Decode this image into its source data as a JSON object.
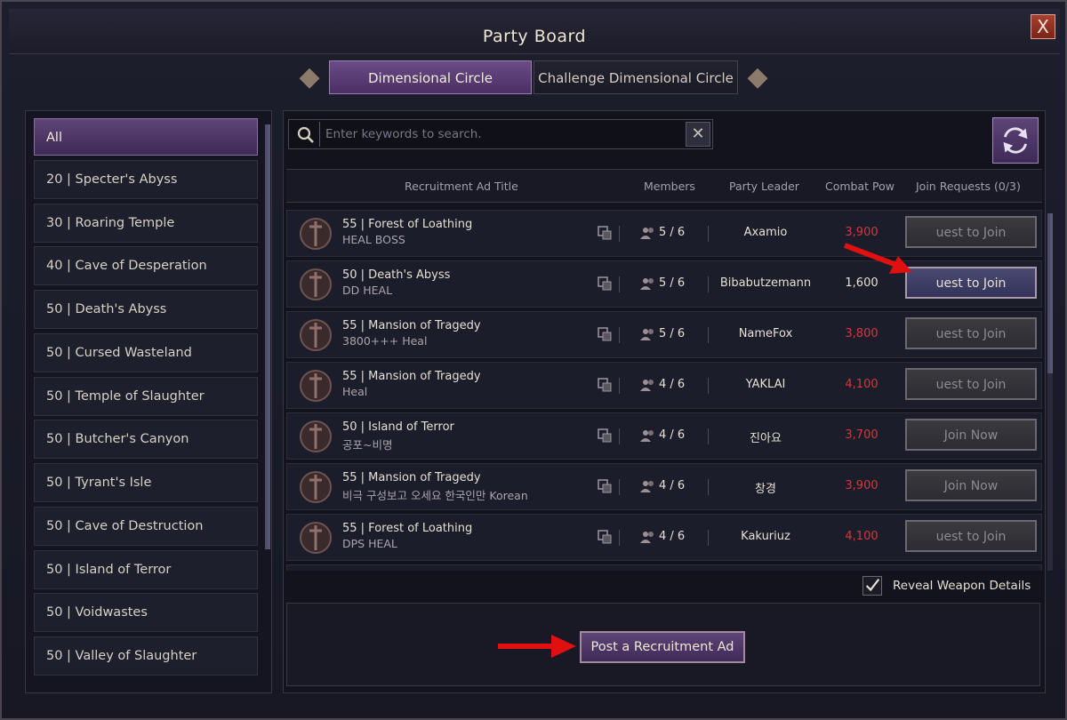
{
  "window": {
    "title": "Party Board",
    "close_label": "X"
  },
  "tabs": [
    {
      "label": "Dimensional Circle",
      "active": true
    },
    {
      "label": "Challenge Dimensional Circle",
      "active": false
    }
  ],
  "sidebar": {
    "items": [
      {
        "label": "All",
        "active": true
      },
      {
        "label": "20 | Specter's Abyss"
      },
      {
        "label": "30 | Roaring Temple"
      },
      {
        "label": "40 | Cave of Desperation"
      },
      {
        "label": "50 | Death's Abyss"
      },
      {
        "label": "50 | Cursed Wasteland"
      },
      {
        "label": "50 | Temple of Slaughter"
      },
      {
        "label": "50 | Butcher's Canyon"
      },
      {
        "label": "50 | Tyrant's Isle"
      },
      {
        "label": "50 | Cave of Destruction"
      },
      {
        "label": "50 | Island of Terror"
      },
      {
        "label": "50 | Voidwastes"
      },
      {
        "label": "50 | Valley of Slaughter"
      }
    ]
  },
  "search": {
    "placeholder": "Enter keywords to search.",
    "clear_label": "✕"
  },
  "table": {
    "headers": {
      "title": "Recruitment Ad Title",
      "members": "Members",
      "leader": "Party Leader",
      "power": "Combat Pow",
      "requests": "Join Requests (0/3)"
    },
    "rows": [
      {
        "title": "55 | Forest of Loathing",
        "sub": "HEAL BOSS",
        "members": "5 / 6",
        "leader": "Axamio",
        "power": "3,900",
        "power_color": "red",
        "button": "uest to Join",
        "button_state": "disabled"
      },
      {
        "title": "50 | Death's Abyss",
        "sub": "DD HEAL",
        "members": "5 / 6",
        "leader": "Bibabutzemann",
        "power": "1,600",
        "power_color": "white",
        "button": "uest to Join",
        "button_state": "enabled"
      },
      {
        "title": "55 | Mansion of Tragedy",
        "sub": "3800+++ Heal",
        "members": "5 / 6",
        "leader": "NameFox",
        "power": "3,800",
        "power_color": "red",
        "button": "uest to Join",
        "button_state": "disabled"
      },
      {
        "title": "55 | Mansion of Tragedy",
        "sub": "Heal",
        "members": "4 / 6",
        "leader": "YAKLAI",
        "power": "4,100",
        "power_color": "red",
        "button": "uest to Join",
        "button_state": "disabled"
      },
      {
        "title": "50 | Island of Terror",
        "sub": "공포~비명",
        "members": "4 / 6",
        "leader": "진아요",
        "power": "3,700",
        "power_color": "red",
        "button": "Join Now",
        "button_state": "disabled"
      },
      {
        "title": "55 | Mansion of Tragedy",
        "sub": "비극 구성보고 오세요 한국인만 Korean",
        "members": "4 / 6",
        "leader": "창경",
        "power": "3,900",
        "power_color": "red",
        "button": "Join Now",
        "button_state": "disabled"
      },
      {
        "title": "55 | Forest of Loathing",
        "sub": "DPS HEAL",
        "members": "4 / 6",
        "leader": "Kakuriuz",
        "power": "4,100",
        "power_color": "red",
        "button": "uest to Join",
        "button_state": "disabled"
      }
    ]
  },
  "reveal_weapon": {
    "label": "Reveal Weapon Details",
    "checked": true
  },
  "post_button": {
    "label": "Post a Recruitment Ad"
  },
  "colors": {
    "accent_purple": "#5e4478",
    "power_red": "#d4383a",
    "annotation_red": "#e01010"
  }
}
